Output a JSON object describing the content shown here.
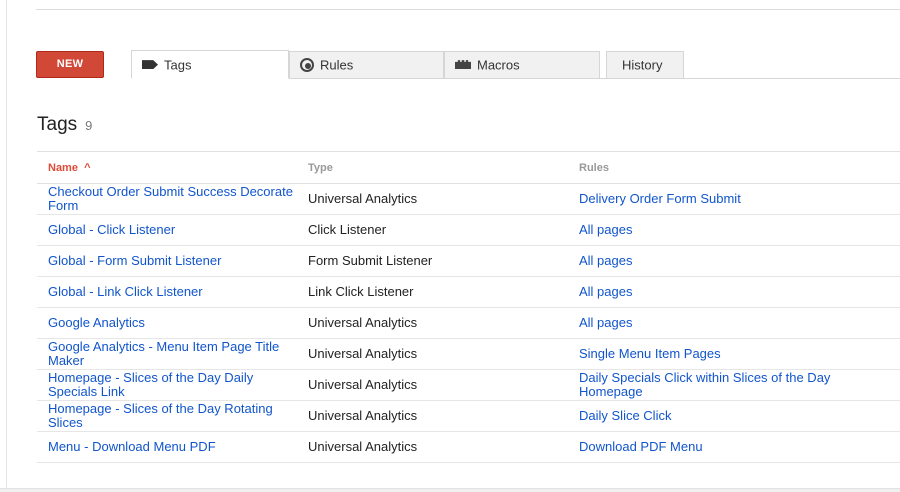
{
  "toolbar": {
    "new_label": "NEW"
  },
  "tabs": [
    {
      "label": "Tags",
      "icon": "tag-icon"
    },
    {
      "label": "Rules",
      "icon": "rules-icon"
    },
    {
      "label": "Macros",
      "icon": "macros-icon"
    },
    {
      "label": "History"
    }
  ],
  "header": {
    "title": "Tags",
    "count": "9"
  },
  "table": {
    "columns": [
      "Name",
      "Type",
      "Rules"
    ],
    "sort_indicator": "^",
    "rows": [
      {
        "name": "Checkout Order Submit Success Decorate Form",
        "type": "Universal Analytics",
        "rules": "Delivery Order Form Submit"
      },
      {
        "name": "Global - Click Listener",
        "type": "Click Listener",
        "rules": "All pages"
      },
      {
        "name": "Global - Form Submit Listener",
        "type": "Form Submit Listener",
        "rules": "All pages"
      },
      {
        "name": "Global - Link Click Listener",
        "type": "Link Click Listener",
        "rules": "All pages"
      },
      {
        "name": "Google Analytics",
        "type": "Universal Analytics",
        "rules": "All pages"
      },
      {
        "name": "Google Analytics - Menu Item Page Title Maker",
        "type": "Universal Analytics",
        "rules": "Single Menu Item Pages"
      },
      {
        "name": "Homepage - Slices of the Day Daily Specials Link",
        "type": "Universal Analytics",
        "rules": "Daily Specials Click within Slices of the Day Homepage"
      },
      {
        "name": "Homepage - Slices of the Day Rotating Slices",
        "type": "Universal Analytics",
        "rules": "Daily Slice Click"
      },
      {
        "name": "Menu - Download Menu PDF",
        "type": "Universal Analytics",
        "rules": "Download PDF Menu"
      }
    ]
  },
  "colors": {
    "accent": "#d14836",
    "link": "#1155cc",
    "sorted_header": "#dd4b39"
  }
}
